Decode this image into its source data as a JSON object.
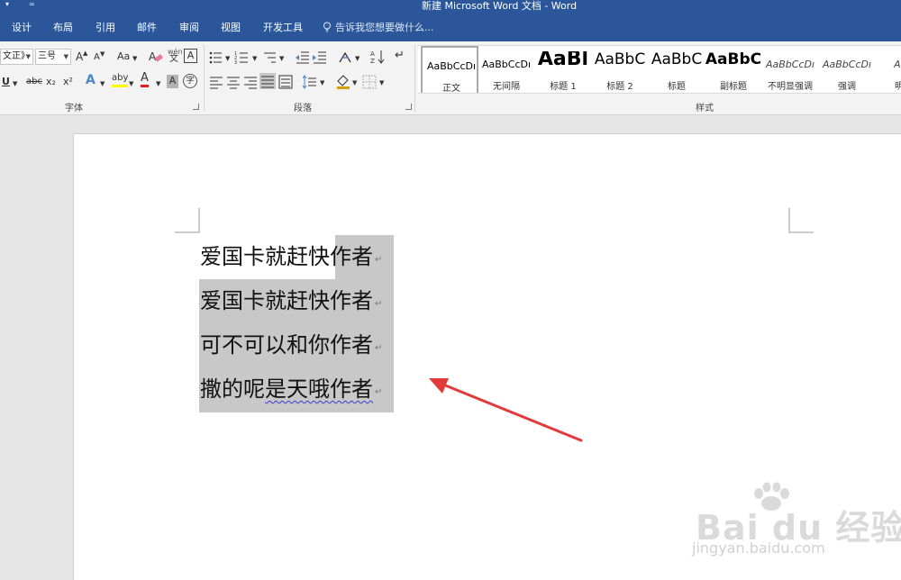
{
  "window": {
    "title": "新建 Microsoft Word 文档 - Word",
    "qat_customize": "▾",
    "qat_more": "="
  },
  "tabs": [
    "设计",
    "布局",
    "引用",
    "邮件",
    "审阅",
    "视图",
    "开发工具"
  ],
  "tell_me": {
    "placeholder": "告诉我您想要做什么..."
  },
  "font_group": {
    "label": "字体",
    "font_name": "文正》",
    "font_size": "三号",
    "grow_font": "A",
    "shrink_font": "A",
    "change_case": "Aa",
    "phonetic_guide": "wén",
    "char_border": "A",
    "underline": "U",
    "strikethrough": "abc",
    "subscript": "x₂",
    "superscript": "x²",
    "text_effects": "A",
    "highlight": "aby",
    "font_color": "A",
    "char_shading": "A",
    "enclose_char": "字"
  },
  "paragraph_group": {
    "label": "段落"
  },
  "styles_group": {
    "label": "样式",
    "items": [
      {
        "preview": "AaBbCcDı",
        "name": "正文",
        "size": 11,
        "bold": false,
        "italic": false,
        "selected": true
      },
      {
        "preview": "AaBbCcDı",
        "name": "无间隔",
        "size": 11,
        "bold": false,
        "italic": false,
        "selected": false
      },
      {
        "preview": "AaBl",
        "name": "标题 1",
        "size": 22,
        "bold": true,
        "italic": false,
        "selected": false
      },
      {
        "preview": "AaBbC",
        "name": "标题 2",
        "size": 17,
        "bold": false,
        "italic": false,
        "selected": false
      },
      {
        "preview": "AaBbC",
        "name": "标题",
        "size": 17,
        "bold": false,
        "italic": false,
        "selected": false
      },
      {
        "preview": "AaBbC",
        "name": "副标题",
        "size": 17,
        "bold": true,
        "italic": false,
        "selected": false
      },
      {
        "preview": "AaBbCcDı",
        "name": "不明显强调",
        "size": 11,
        "bold": false,
        "italic": true,
        "selected": false
      },
      {
        "preview": "AaBbCcDı",
        "name": "强调",
        "size": 11,
        "bold": false,
        "italic": true,
        "selected": false
      },
      {
        "preview": "AaB",
        "name": "明显",
        "size": 11,
        "bold": false,
        "italic": true,
        "selected": false
      }
    ]
  },
  "document": {
    "lines": [
      {
        "text": "爱国卡就赶快作者",
        "mark": "↵"
      },
      {
        "text": "爱国卡就赶快作者",
        "mark": "↵"
      },
      {
        "text": "可不可以和你作者",
        "mark": "↵"
      },
      {
        "text_plain": "撒的呢",
        "text_squiggle": "是天哦作者",
        "mark": "↵"
      }
    ]
  },
  "watermark": {
    "brand": "Bai du 经验",
    "url": "jingyan.baidu.com"
  },
  "colors": {
    "brand_blue": "#2b579a",
    "selection": "#c8c8c8",
    "arrow_red": "#e23b3b"
  }
}
